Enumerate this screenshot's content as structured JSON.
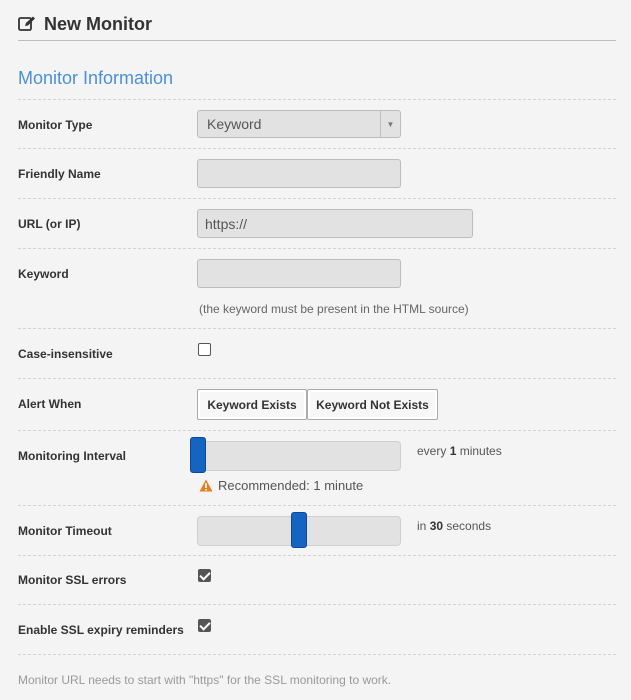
{
  "header": {
    "title": "New Monitor",
    "icon": "edit-icon"
  },
  "section": {
    "title": "Monitor Information"
  },
  "fields": {
    "monitor_type": {
      "label": "Monitor Type",
      "value": "Keyword"
    },
    "friendly_name": {
      "label": "Friendly Name",
      "value": ""
    },
    "url": {
      "label": "URL (or IP)",
      "value": "https://"
    },
    "keyword": {
      "label": "Keyword",
      "value": "",
      "hint": "(the keyword must be present in the HTML source)"
    },
    "case_insensitive": {
      "label": "Case-insensitive",
      "checked": false
    },
    "alert_when": {
      "label": "Alert When",
      "options": [
        "Keyword Exists",
        "Keyword Not Exists"
      ]
    },
    "interval": {
      "label": "Monitoring Interval",
      "prefix": "every ",
      "value": "1",
      "suffix": " minutes",
      "level": 0.0,
      "warning": "Recommended: 1 minute",
      "warning_icon": "warning-icon",
      "warning_color": "#e67e22"
    },
    "timeout": {
      "label": "Monitor Timeout",
      "prefix": "in ",
      "value": "30",
      "suffix": " seconds",
      "level": 0.5
    },
    "ssl_errors": {
      "label": "Monitor SSL errors",
      "checked": true
    },
    "ssl_expiry": {
      "label": "Enable SSL expiry reminders",
      "checked": true
    }
  },
  "footer": {
    "note": "Monitor URL needs to start with \"https\" for the SSL monitoring to work."
  },
  "colors": {
    "accent": "#4a90d9",
    "slider_handle": "#1565c0"
  }
}
